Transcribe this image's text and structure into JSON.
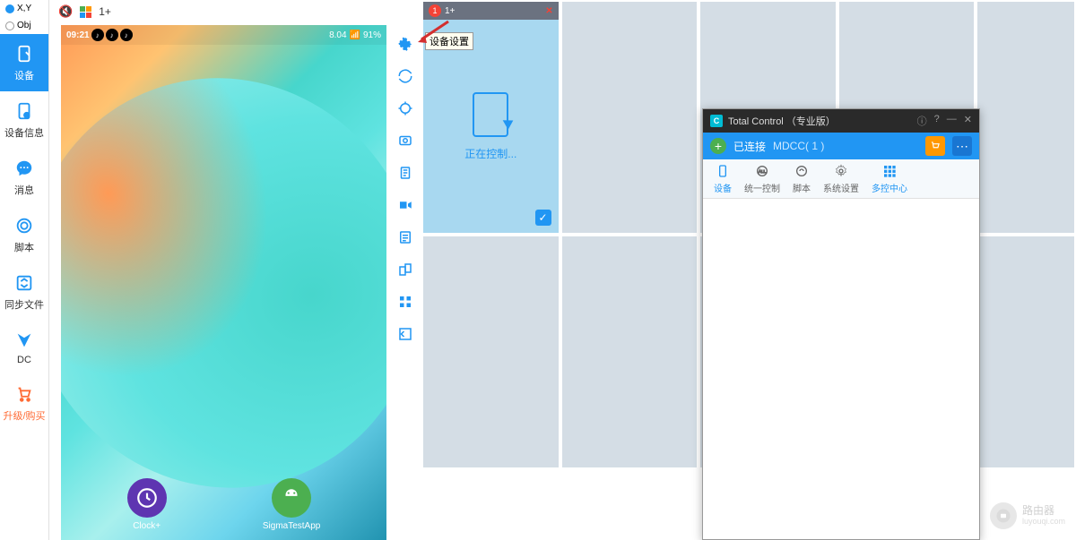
{
  "top": {
    "xy": "X,Y",
    "obj": "Obj",
    "device_label": "1+"
  },
  "sidebar": {
    "items": [
      {
        "label": "设备"
      },
      {
        "label": "设备信息"
      },
      {
        "label": "消息"
      },
      {
        "label": "脚本"
      },
      {
        "label": "同步文件"
      },
      {
        "label": "DC"
      },
      {
        "label": "升级/购买"
      }
    ]
  },
  "phone": {
    "time": "09:21",
    "battery": "91%",
    "version": "8.04",
    "apps": [
      {
        "name": "Clock+"
      },
      {
        "name": "SigmaTestApp"
      }
    ]
  },
  "tooltip": "设备设置",
  "cell": {
    "badge": "1",
    "title": "1+",
    "status": "正在控制..."
  },
  "tc": {
    "title": "Total Control （专业版）",
    "connected": "已连接",
    "device_group": "MDCC( 1 )",
    "tabs": [
      {
        "label": "设备"
      },
      {
        "label": "统一控制"
      },
      {
        "label": "脚本"
      },
      {
        "label": "系统设置"
      },
      {
        "label": "多控中心"
      }
    ]
  },
  "watermark": {
    "title": "路由器",
    "sub": "luyouqi.com"
  }
}
